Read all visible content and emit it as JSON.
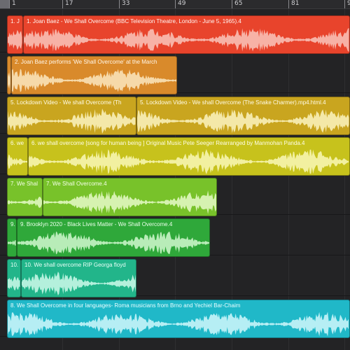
{
  "ruler": {
    "labels": [
      "1",
      "17",
      "33",
      "49",
      "65",
      "81",
      "9"
    ]
  },
  "tracks": [
    {
      "name": "track-1",
      "color": "#e8442c",
      "wave": "#f7b2a6",
      "text": "#fff4f0",
      "regions": [
        {
          "label": "1. J"
        },
        {
          "label": "1. Joan Baez - We Shall Overcome (BBC Television Theatre, London - June 5, 1965).4"
        }
      ]
    },
    {
      "name": "track-2",
      "color": "#d98a2b",
      "wave": "#f6d9a9",
      "text": "#fff6e8",
      "regions": [
        {
          "label": ""
        },
        {
          "label": "2. Joan Baez performs 'We Shall Overcome' at the March"
        }
      ]
    },
    {
      "name": "track-3",
      "color": "#c9a51f",
      "wave": "#f4e8a8",
      "text": "#fffbe6",
      "regions": [
        {
          "label": "5. Lockdown Video - We shall Overcome (Th"
        },
        {
          "label": "5. Lockdown Video - We shall Overcome (The Snake Charmer).mp4.html.4"
        }
      ]
    },
    {
      "name": "track-4",
      "color": "#c7c21c",
      "wave": "#f2f0a0",
      "text": "#fffde8",
      "regions": [
        {
          "label": "6. we"
        },
        {
          "label": "6. we shall overcome [song for  human being ] Original Music Pete Seeger  Rearranged by Manmohan  Panda.4"
        }
      ]
    },
    {
      "name": "track-5",
      "color": "#78c22a",
      "wave": "#d6f2b0",
      "text": "#f4ffe8",
      "regions": [
        {
          "label": "7. We Shal"
        },
        {
          "label": "7. We Shall Overcome.4"
        }
      ]
    },
    {
      "name": "track-6",
      "color": "#2fa83a",
      "wave": "#b8ecb8",
      "text": "#eaffea",
      "regions": [
        {
          "label": "9."
        },
        {
          "label": "9. Brooklyn 2020 - Black Lives Matter - We Shall Overcome.4"
        }
      ]
    },
    {
      "name": "track-7",
      "color": "#22b58a",
      "wave": "#b4f0dc",
      "text": "#e8fff7",
      "regions": [
        {
          "label": "10."
        },
        {
          "label": "10. We shall overcome RIP Georga floyd"
        }
      ]
    },
    {
      "name": "track-8",
      "color": "#20b8c8",
      "wave": "#b6eef4",
      "text": "#e8fdff",
      "regions": [
        {
          "label": "8. We Shall Overcome in four languages- Roma musicians from Brno and Yechiel Bar-Chaim"
        }
      ]
    }
  ]
}
